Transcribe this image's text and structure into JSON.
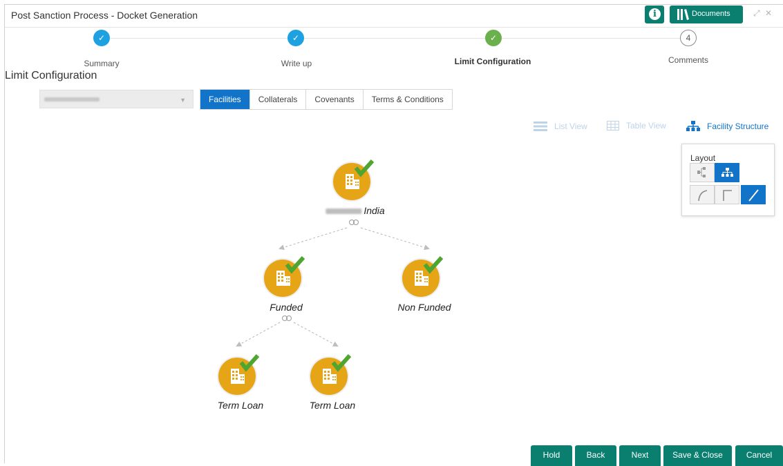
{
  "window": {
    "title": "Post Sanction Process - Docket Generation",
    "documents_label": "Documents"
  },
  "steps": [
    {
      "label": "Summary",
      "status": "done"
    },
    {
      "label": "Write up",
      "status": "done"
    },
    {
      "label": "Limit Configuration",
      "status": "current"
    },
    {
      "label": "Comments",
      "status": "pending",
      "number": "4"
    }
  ],
  "section_title": "Limit Configuration",
  "tabs": [
    "Facilities",
    "Collaterals",
    "Covenants",
    "Terms & Conditions"
  ],
  "views": {
    "list": "List View",
    "table": "Table View",
    "structure": "Facility Structure"
  },
  "layout_panel": {
    "label": "Layout"
  },
  "tree": {
    "root": "India",
    "level1": [
      "Funded",
      "Non Funded"
    ],
    "level2": [
      "Term Loan",
      "Term Loan"
    ]
  },
  "actions": [
    "Hold",
    "Back",
    "Next",
    "Save & Close",
    "Cancel"
  ],
  "colors": {
    "teal": "#0a7f70",
    "blue": "#1174c9",
    "done_blue": "#1ea1e0",
    "done_green": "#6ab04c",
    "node_gold": "#e6a417",
    "check": "#4fa52f"
  }
}
